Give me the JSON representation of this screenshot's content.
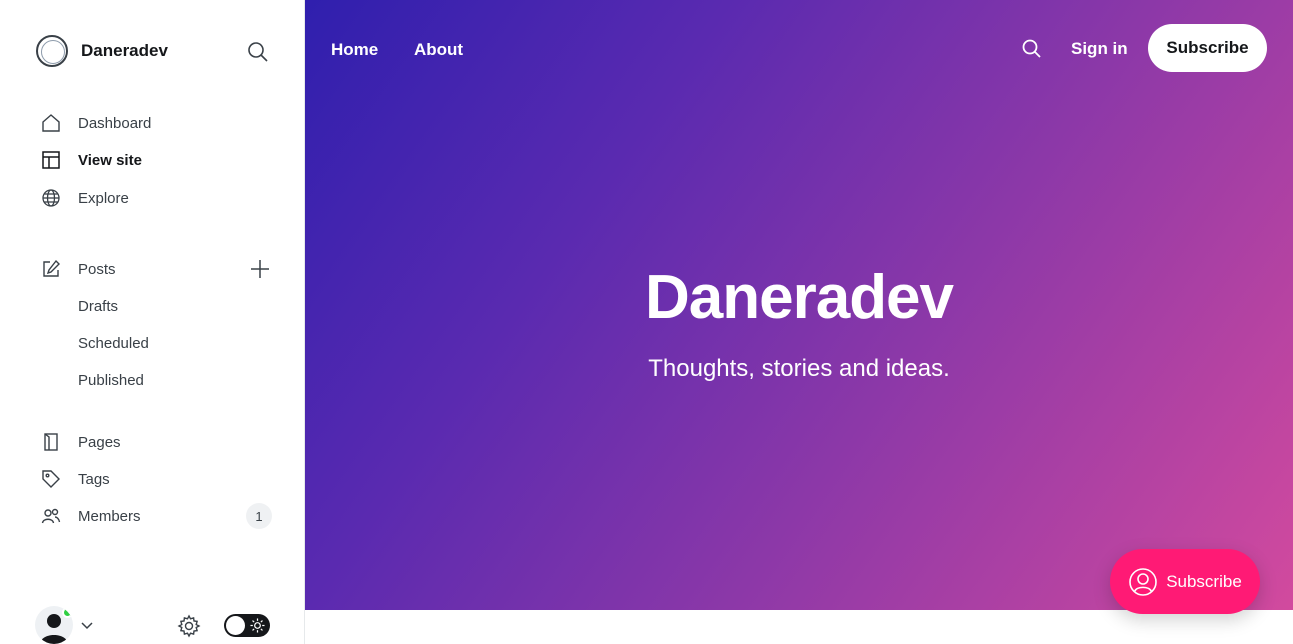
{
  "sidebar": {
    "brand_name": "Daneradev",
    "items": [
      {
        "label": "Dashboard",
        "icon": "home-icon"
      },
      {
        "label": "View site",
        "icon": "layout-icon"
      },
      {
        "label": "Explore",
        "icon": "globe-icon"
      },
      {
        "label": "Posts",
        "icon": "edit-icon"
      },
      {
        "label": "Pages",
        "icon": "page-icon"
      },
      {
        "label": "Tags",
        "icon": "tag-icon"
      },
      {
        "label": "Members",
        "icon": "members-icon",
        "count": "1"
      }
    ],
    "post_subitems": [
      "Drafts",
      "Scheduled",
      "Published"
    ],
    "active_item": "View site",
    "status_color": "#30cf43"
  },
  "site": {
    "nav": [
      "Home",
      "About"
    ],
    "sign_in": "Sign in",
    "subscribe": "Subscribe",
    "title": "Daneradev",
    "tagline": "Thoughts, stories and ideas.",
    "gradient_start": "#2f1fae",
    "gradient_end": "#d24a9e"
  },
  "portal": {
    "label": "Subscribe",
    "color": "#ff1a75"
  }
}
